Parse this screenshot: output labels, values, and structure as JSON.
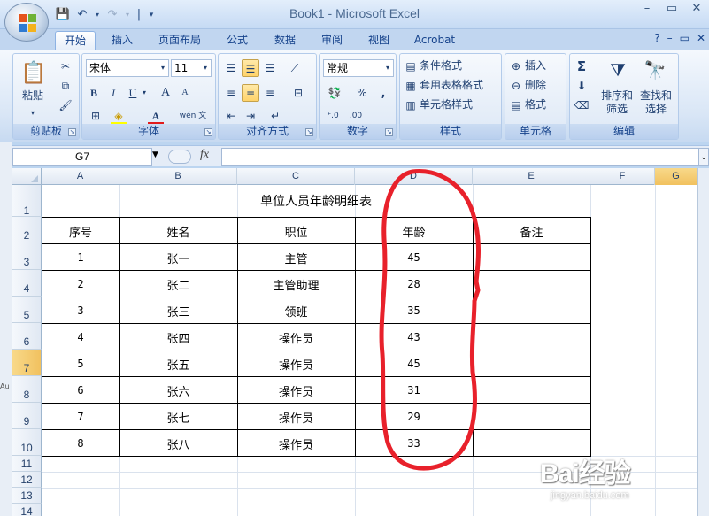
{
  "window": {
    "title": "Book1 - Microsoft Excel",
    "controls": [
      "–",
      "▭",
      "✕"
    ]
  },
  "ribbon_tabs": [
    "开始",
    "插入",
    "页面布局",
    "公式",
    "数据",
    "审阅",
    "视图",
    "Acrobat"
  ],
  "active_tab": "开始",
  "ribbon": {
    "clipboard": {
      "label": "剪贴板",
      "paste": "粘贴"
    },
    "font": {
      "label": "字体",
      "name": "宋体",
      "size": "11",
      "bold": "B",
      "italic": "I",
      "underline": "U",
      "grow": "A",
      "shrink": "A",
      "phonetic": "wén 文"
    },
    "alignment": {
      "label": "对齐方式"
    },
    "number": {
      "label": "数字",
      "format": "常规",
      "percent": "%",
      "comma": ","
    },
    "styles": {
      "label": "样式",
      "conditional": "条件格式",
      "table": "套用表格格式",
      "cell": "单元格样式"
    },
    "cells": {
      "label": "单元格",
      "insert": "插入",
      "delete": "删除",
      "format": "格式"
    },
    "editing": {
      "label": "编辑",
      "sum": "Σ",
      "sort": "排序和\n筛选",
      "find": "查找和\n选择"
    }
  },
  "formula_bar": {
    "name_box": "G7",
    "fx": "fx",
    "content": ""
  },
  "sheet": {
    "columns": [
      "A",
      "B",
      "C",
      "D",
      "E",
      "F",
      "G"
    ],
    "selected_column": "G",
    "rows": [
      "1",
      "2",
      "3",
      "4",
      "5",
      "6",
      "7",
      "8",
      "9",
      "10",
      "11",
      "12",
      "13",
      "14"
    ],
    "selected_row": "7",
    "title": "单位人员年龄明细表",
    "headers": [
      "序号",
      "姓名",
      "职位",
      "年龄",
      "备注"
    ],
    "data": [
      [
        "1",
        "张一",
        "主管",
        "45",
        ""
      ],
      [
        "2",
        "张二",
        "主管助理",
        "28",
        ""
      ],
      [
        "3",
        "张三",
        "领班",
        "35",
        ""
      ],
      [
        "4",
        "张四",
        "操作员",
        "43",
        ""
      ],
      [
        "5",
        "张五",
        "操作员",
        "45",
        ""
      ],
      [
        "6",
        "张六",
        "操作员",
        "31",
        ""
      ],
      [
        "7",
        "张七",
        "操作员",
        "29",
        ""
      ],
      [
        "8",
        "张八",
        "操作员",
        "33",
        ""
      ]
    ]
  },
  "annotation_color": "#e8212b",
  "left_fragment": "Au",
  "watermark": {
    "main": "Bai经验",
    "sub": "jingyan.baidu.com"
  }
}
